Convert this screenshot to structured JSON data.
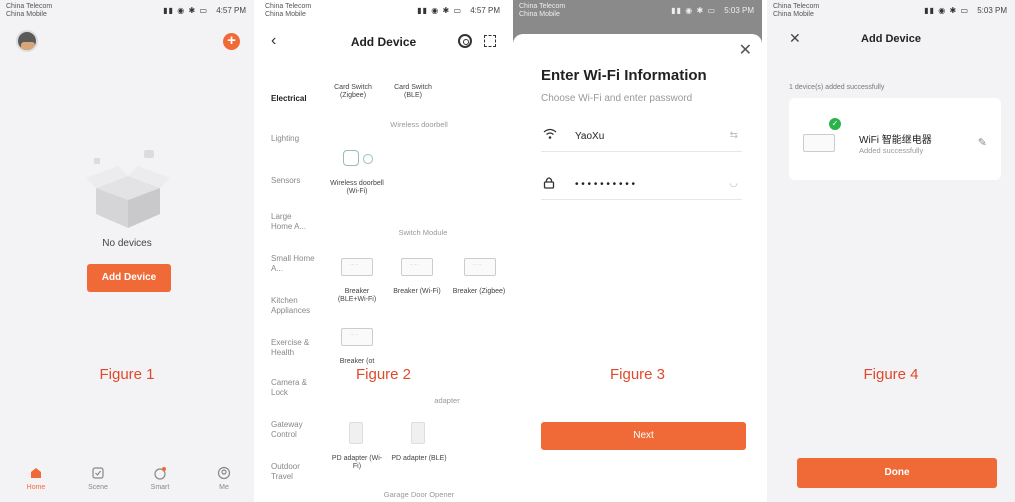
{
  "panel1": {
    "status": {
      "carrier1": "China Telecom",
      "carrier2": "China Mobile",
      "time": "4:57 PM"
    },
    "empty_text": "No devices",
    "add_button": "Add Device",
    "tabs": [
      {
        "label": "Home",
        "icon": "home-icon",
        "active": true
      },
      {
        "label": "Scene",
        "icon": "scene-icon",
        "active": false
      },
      {
        "label": "Smart",
        "icon": "smart-icon",
        "active": false
      },
      {
        "label": "Me",
        "icon": "me-icon",
        "active": false
      }
    ],
    "figure": "Figure 1"
  },
  "panel2": {
    "status": {
      "carrier1": "China Telecom",
      "carrier2": "China Mobile",
      "time": "4:57 PM"
    },
    "title": "Add Device",
    "categories": [
      "Electrical",
      "Lighting",
      "Sensors",
      "Large Home A...",
      "Small Home A...",
      "Kitchen Appliances",
      "Exercise & Health",
      "Camera & Lock",
      "Gateway Control",
      "Outdoor Travel"
    ],
    "top_devices": [
      "Card Switch (Zigbee)",
      "Card Switch (BLE)"
    ],
    "sections": {
      "doorbell": "Wireless doorbell",
      "switch_module": "Switch Module",
      "adapter": "adapter",
      "garage": "Garage Door Opener"
    },
    "doorbell_item": "Wireless doorbell (Wi-Fi)",
    "breakers": [
      "Breaker (BLE+Wi-Fi)",
      "Breaker (Wi-Fi)",
      "Breaker (Zigbee)"
    ],
    "breaker_other": "Breaker (ot",
    "adapters": [
      "PD adapter (Wi-Fi)",
      "PD adapter (BLE)"
    ],
    "figure": "Figure 2"
  },
  "panel3": {
    "status": {
      "carrier1": "China Telecom",
      "carrier2": "China Mobile",
      "time": "5:03 PM"
    },
    "title": "Enter Wi-Fi Information",
    "subtitle": "Choose Wi-Fi and enter password",
    "ssid": "YaoXu",
    "password_mask": "• • • • • • • • • •",
    "next_button": "Next",
    "figure": "Figure 3"
  },
  "panel4": {
    "status": {
      "carrier1": "China Telecom",
      "carrier2": "China Mobile",
      "time": "5:03 PM"
    },
    "title": "Add Device",
    "added_count": "1 device(s) added successfully",
    "device_name": "WiFi 智能继电器",
    "device_status": "Added successfully",
    "done_button": "Done",
    "figure": "Figure 4"
  },
  "accent_color": "#f06a38",
  "figure_color": "#e0492b"
}
